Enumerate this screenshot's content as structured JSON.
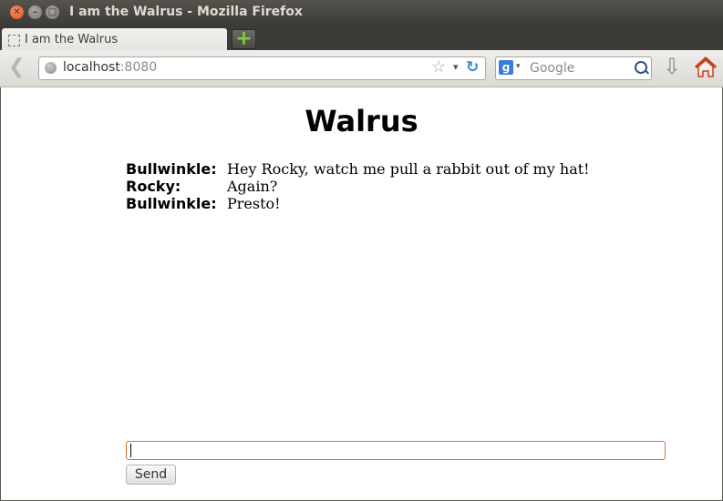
{
  "window": {
    "title": "I am the Walrus - Mozilla Firefox",
    "close_glyph": "✕",
    "min_glyph": "–",
    "max_glyph": "□"
  },
  "tabs": [
    {
      "label": "I am the Walrus",
      "active": true
    }
  ],
  "new_tab_glyph": "+",
  "navbar": {
    "back_glyph": "❮",
    "url_host": "localhost",
    "url_port": ":8080",
    "star_glyph": "☆",
    "dropdown_glyph": "▾",
    "reload_glyph": "↻",
    "search_engine_glyph": "g",
    "search_placeholder": "Google",
    "download_glyph": "⇩"
  },
  "page": {
    "heading": "Walrus",
    "messages": [
      {
        "speaker": "Bullwinkle:",
        "text": "Hey Rocky, watch me pull a rabbit out of my hat!"
      },
      {
        "speaker": "Rocky:",
        "text": "Again?"
      },
      {
        "speaker": "Bullwinkle:",
        "text": "Presto!"
      }
    ],
    "input_value": "",
    "send_label": "Send"
  },
  "colors": {
    "accent_input_border": "#e06b3c",
    "titlebar": "#3c3b37",
    "close_button": "#e1531c",
    "new_tab_plus": "#7fcf32"
  },
  "icons": [
    "close-icon",
    "minimize-icon",
    "maximize-icon",
    "page-icon",
    "plus-icon",
    "back-arrow-icon",
    "globe-icon",
    "star-icon",
    "dropdown-icon",
    "reload-icon",
    "google-icon",
    "search-icon",
    "download-icon",
    "home-icon"
  ]
}
